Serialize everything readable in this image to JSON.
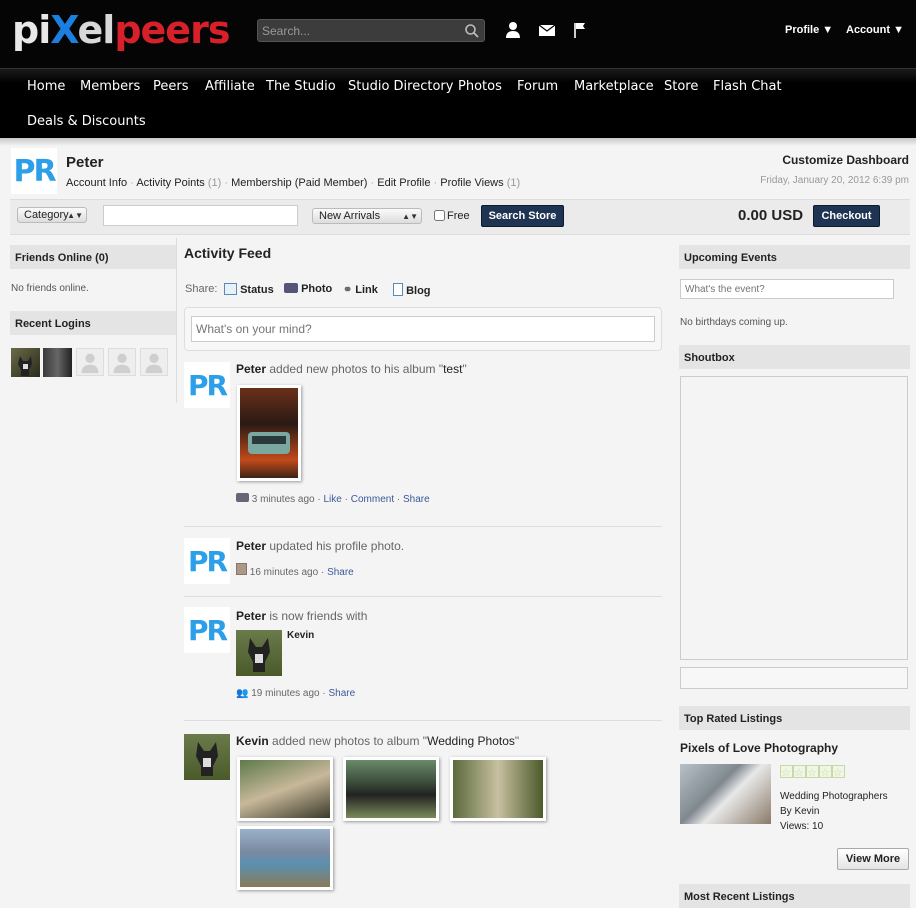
{
  "brand": {
    "logo": "pixelpeers"
  },
  "topbar": {
    "search_placeholder": "Search...",
    "profile_menu": "Profile",
    "account_menu": "Account"
  },
  "nav": {
    "items": [
      "Home",
      "Members",
      "Peers",
      "Affiliate",
      "The Studio",
      "Studio Directory",
      "Photos",
      "Forum",
      "Marketplace",
      "Store",
      "Flash Chat",
      "Deals & Discounts"
    ]
  },
  "profile": {
    "avatar_text": "PR",
    "name": "Peter",
    "links": [
      "Account Info",
      "Activity Points",
      "Membership (Paid Member)",
      "Edit Profile",
      "Profile Views"
    ],
    "activity_count": "(1)",
    "views_count": "(1)",
    "customize": "Customize Dashboard",
    "date": "Friday, January 20, 2012 6:39 pm"
  },
  "store": {
    "category": "Category",
    "sort": "New Arrivals",
    "free_label": "Free",
    "search_button": "Search Store",
    "total": "0.00 USD",
    "checkout": "Checkout"
  },
  "left": {
    "friends_title": "Friends Online (0)",
    "friends_empty": "No friends online.",
    "logins_title": "Recent Logins"
  },
  "feed": {
    "title": "Activity Feed",
    "share_label": "Share:",
    "share_opts": [
      "Status",
      "Photo",
      "Link",
      "Blog"
    ],
    "mind_placeholder": "What's on your mind?",
    "entries": [
      {
        "who": "Peter",
        "pre": "added new photos to his album \"",
        "album": "test",
        "post": "\"",
        "time": "3 minutes ago",
        "actions": [
          "Like",
          "Comment",
          "Share"
        ]
      },
      {
        "who": "Peter",
        "pre": "updated his profile photo.",
        "time": "16 minutes ago",
        "actions": [
          "Share"
        ]
      },
      {
        "who": "Peter",
        "pre": "is now friends with",
        "friend": "Kevin",
        "time": "19 minutes ago",
        "actions": [
          "Share"
        ]
      },
      {
        "who": "Kevin",
        "pre": "added new photos to album \"",
        "album": "Wedding Photos",
        "post": "\""
      }
    ]
  },
  "right": {
    "events_title": "Upcoming Events",
    "events_placeholder": "What's the event?",
    "birthdays": "No birthdays coming up.",
    "shoutbox_title": "Shoutbox",
    "top_rated_title": "Top Rated Listings",
    "listing_title": "Pixels of Love Photography",
    "listing_cat": "Wedding Photographers",
    "listing_by": "By Kevin",
    "listing_views": "Views: 10",
    "view_more": "View More",
    "recent_title": "Most Recent Listings"
  },
  "colors": {
    "accent": "#1f3452",
    "link": "#3b5998",
    "brand_blue": "#1c7fe0",
    "brand_red": "#d8202a"
  }
}
